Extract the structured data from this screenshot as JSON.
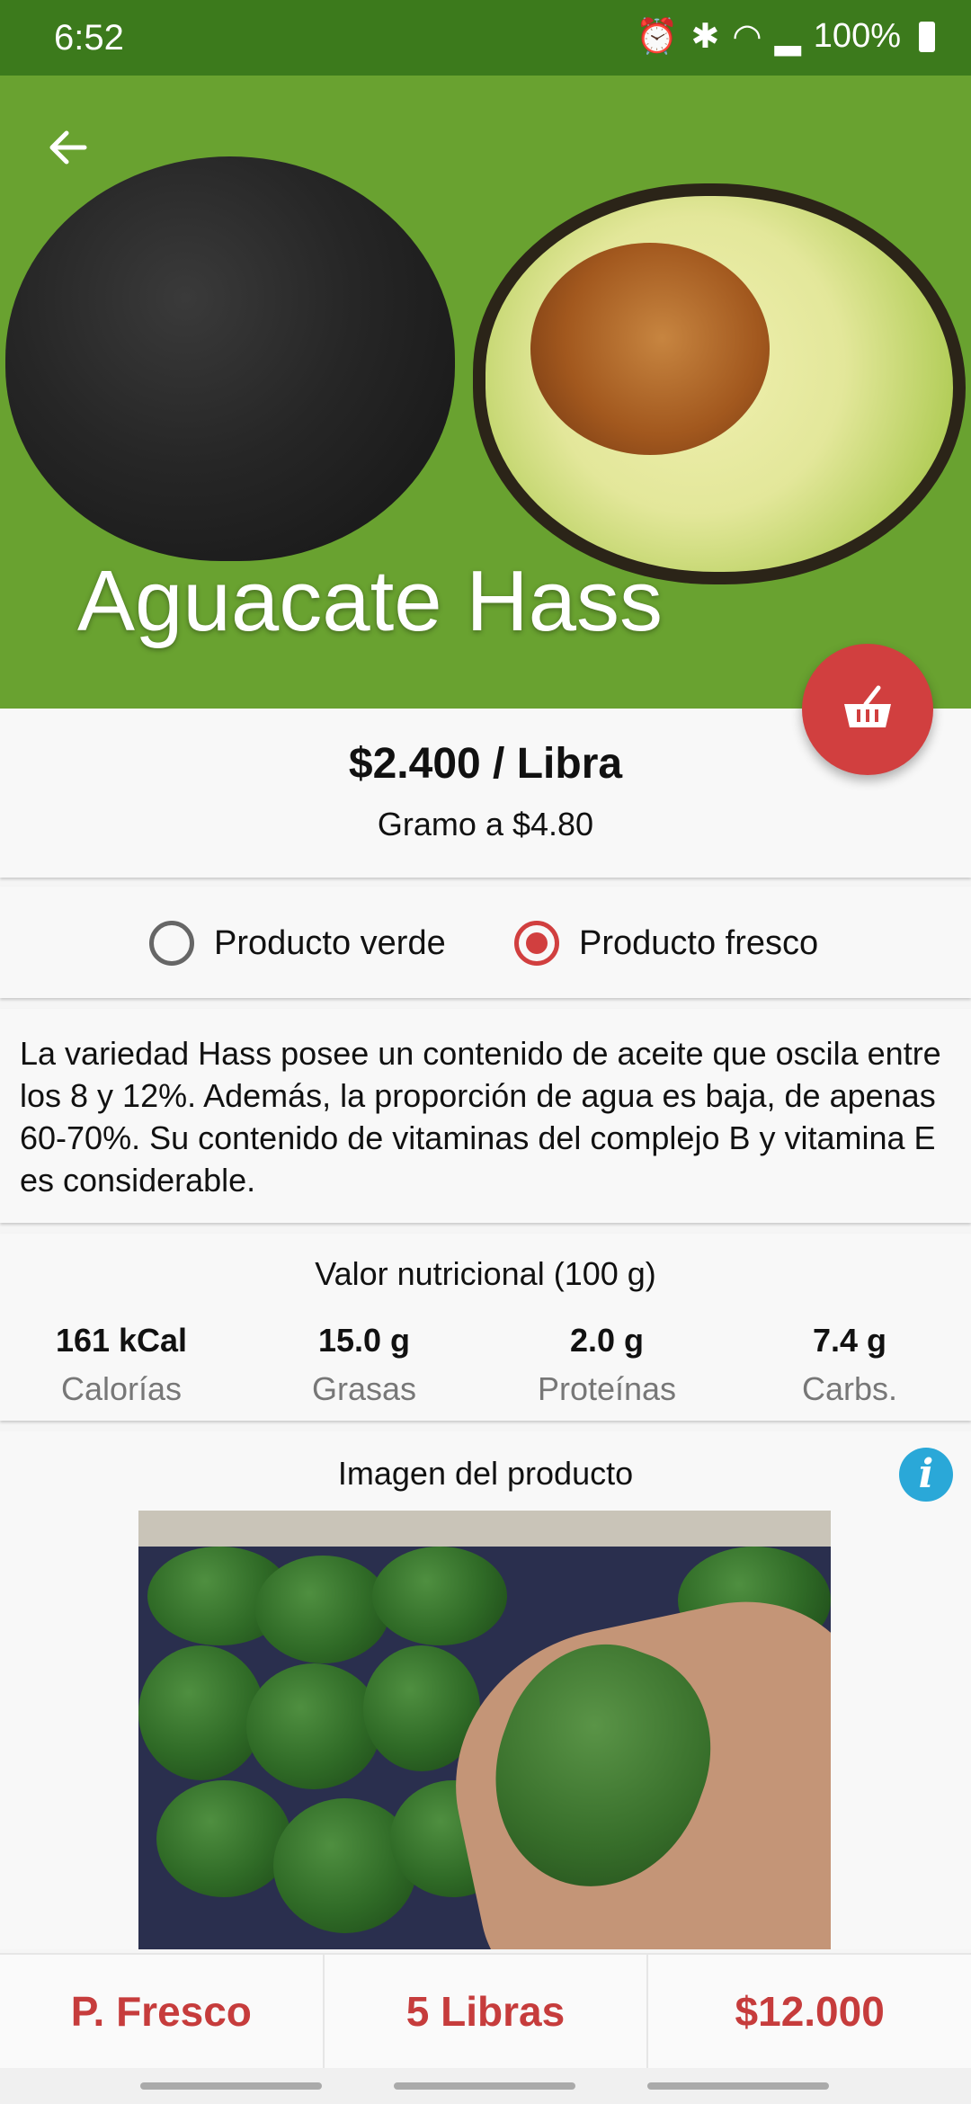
{
  "status_bar": {
    "time": "6:52",
    "battery_text": "100%",
    "icons": [
      "alarm-icon",
      "bluetooth-icon",
      "wifi-icon",
      "signal-icon",
      "battery-icon"
    ]
  },
  "colors": {
    "status_green": "#3c7a1c",
    "hero_green": "#69a230",
    "accent_red": "#d13f3f",
    "info_blue": "#2aa8d8"
  },
  "product": {
    "name": "Aguacate Hass",
    "price": "$2.400 / Libra",
    "per_gram": "Gramo a $4.80",
    "options": [
      {
        "label": "Producto verde",
        "selected": false
      },
      {
        "label": "Producto fresco",
        "selected": true
      }
    ],
    "description": "La variedad Hass posee un contenido de aceite que oscila entre los 8 y 12%. Además, la proporción de agua es baja, de apenas 60-70%. Su contenido de vitaminas del complejo B y vitamina E es considerable."
  },
  "nutrition": {
    "title": "Valor nutricional (100 g)",
    "items": [
      {
        "value": "161 kCal",
        "label": "Calorías"
      },
      {
        "value": "15.0 g",
        "label": "Grasas"
      },
      {
        "value": "2.0 g",
        "label": "Proteínas"
      },
      {
        "value": "7.4 g",
        "label": "Carbs."
      }
    ]
  },
  "image_section": {
    "title": "Imagen del producto"
  },
  "bottom_bar": {
    "type": "P. Fresco",
    "quantity": "5 Libras",
    "total": "$12.000"
  }
}
